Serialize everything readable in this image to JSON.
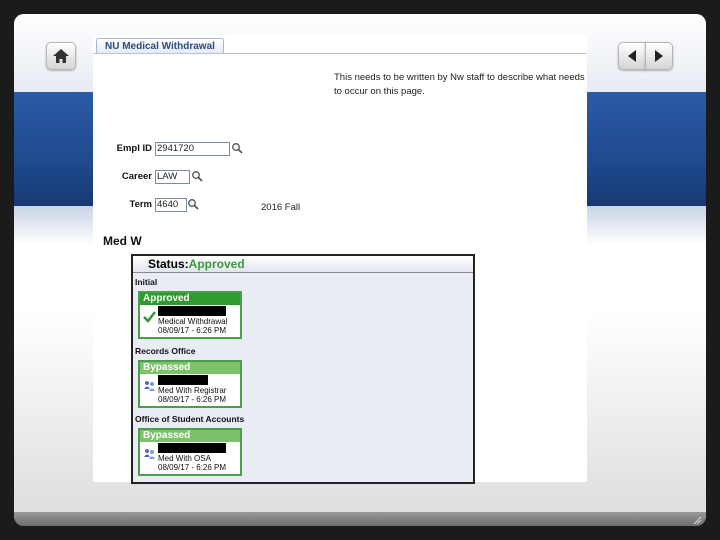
{
  "tab": {
    "label": "NU Medical Withdrawal"
  },
  "description": {
    "line1": "This needs to be written by Nw staff to describe what needs",
    "line2": "to occur on this page."
  },
  "fields": {
    "empl_id": {
      "label": "Empl ID",
      "value": "2941720"
    },
    "career": {
      "label": "Career",
      "value": "LAW"
    },
    "term": {
      "label": "Term",
      "value": "4640",
      "description": "2016 Fall"
    }
  },
  "section_title": "Med W",
  "status": {
    "label": "Status:",
    "value": "Approved"
  },
  "stages": [
    {
      "name": "Initial",
      "status": "Approved",
      "step": "Medical Withdrawal",
      "datetime": "08/09/17 - 6:26 PM"
    },
    {
      "name": "Records Office",
      "status": "Bypassed",
      "step": "Med With Registrar",
      "datetime": "08/09/17 - 6:26 PM"
    },
    {
      "name": "Office of Student Accounts",
      "status": "Bypassed",
      "step": "Med With OSA",
      "datetime": "08/09/17 - 6:26 PM"
    }
  ],
  "colors": {
    "approved": "#2f9a2f",
    "bypassed": "#7cc26a",
    "band": "#1f4a8e"
  }
}
